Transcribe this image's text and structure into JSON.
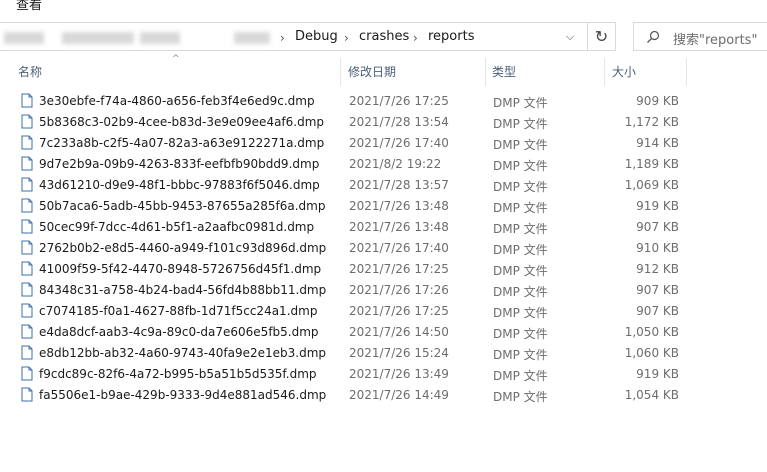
{
  "window": {
    "menu_label": "查看"
  },
  "address": {
    "crumbs": [
      "Debug",
      "crashes",
      "reports"
    ],
    "separator": "›",
    "dropdown_icon": "chevron-down-icon",
    "refresh_icon": "refresh-icon",
    "refresh_glyph": "↻",
    "dropdown_glyph": "⌵"
  },
  "search": {
    "placeholder": "搜索\"reports\""
  },
  "columns": {
    "name": "名称",
    "date": "修改日期",
    "type": "类型",
    "size": "大小",
    "sort_indicator": "^"
  },
  "files": [
    {
      "name": "3e30ebfe-f74a-4860-a656-feb3f4e6ed9c.dmp",
      "date": "2021/7/26 17:25",
      "type": "DMP 文件",
      "size": "909 KB"
    },
    {
      "name": "5b8368c3-02b9-4cee-b83d-3e9e09ee4af6.dmp",
      "date": "2021/7/28 13:54",
      "type": "DMP 文件",
      "size": "1,172 KB"
    },
    {
      "name": "7c233a8b-c2f5-4a07-82a3-a63e9122271a.dmp",
      "date": "2021/7/26 17:40",
      "type": "DMP 文件",
      "size": "914 KB"
    },
    {
      "name": "9d7e2b9a-09b9-4263-833f-eefbfb90bdd9.dmp",
      "date": "2021/8/2 19:22",
      "type": "DMP 文件",
      "size": "1,189 KB"
    },
    {
      "name": "43d61210-d9e9-48f1-bbbc-97883f6f5046.dmp",
      "date": "2021/7/28 13:57",
      "type": "DMP 文件",
      "size": "1,069 KB"
    },
    {
      "name": "50b7aca6-5adb-45bb-9453-87655a285f6a.dmp",
      "date": "2021/7/26 13:48",
      "type": "DMP 文件",
      "size": "919 KB"
    },
    {
      "name": "50cec99f-7dcc-4d61-b5f1-a2aafbc0981d.dmp",
      "date": "2021/7/26 13:48",
      "type": "DMP 文件",
      "size": "907 KB"
    },
    {
      "name": "2762b0b2-e8d5-4460-a949-f101c93d896d.dmp",
      "date": "2021/7/26 17:40",
      "type": "DMP 文件",
      "size": "910 KB"
    },
    {
      "name": "41009f59-5f42-4470-8948-5726756d45f1.dmp",
      "date": "2021/7/26 17:25",
      "type": "DMP 文件",
      "size": "912 KB"
    },
    {
      "name": "84348c31-a758-4b24-bad4-56fd4b88bb11.dmp",
      "date": "2021/7/26 17:26",
      "type": "DMP 文件",
      "size": "907 KB"
    },
    {
      "name": "c7074185-f0a1-4627-88fb-1d71f5cc24a1.dmp",
      "date": "2021/7/26 17:25",
      "type": "DMP 文件",
      "size": "907 KB"
    },
    {
      "name": "e4da8dcf-aab3-4c9a-89c0-da7e606e5fb5.dmp",
      "date": "2021/7/26 14:50",
      "type": "DMP 文件",
      "size": "1,050 KB"
    },
    {
      "name": "e8db12bb-ab32-4a60-9743-40fa9e2e1eb3.dmp",
      "date": "2021/7/26 15:24",
      "type": "DMP 文件",
      "size": "1,060 KB"
    },
    {
      "name": "f9cdc89c-82f6-4a72-b995-b5a51b5d535f.dmp",
      "date": "2021/7/26 13:49",
      "type": "DMP 文件",
      "size": "919 KB"
    },
    {
      "name": "fa5506e1-b9ae-429b-9333-9d4e881ad546.dmp",
      "date": "2021/7/26 14:49",
      "type": "DMP 文件",
      "size": "1,054 KB"
    }
  ],
  "icons": {
    "file": "file-icon",
    "search": "search-icon"
  }
}
